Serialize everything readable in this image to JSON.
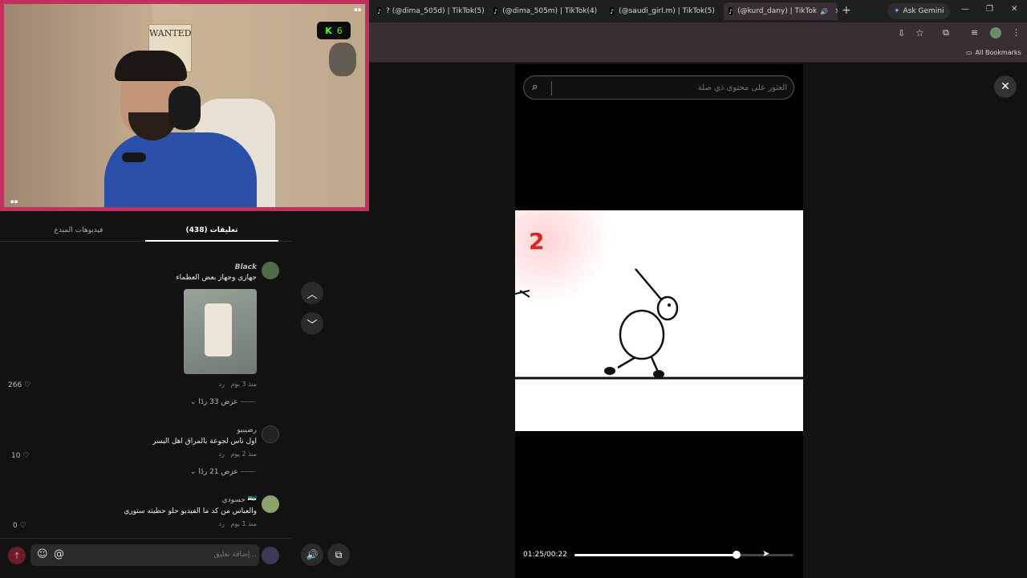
{
  "browser": {
    "tabs": [
      {
        "label": "? (@dima_505d) | TikTok(5)"
      },
      {
        "label": "(@dima_505m) | TikTok(4)"
      },
      {
        "label": "(@saudi_girl.m) | TikTok(5)"
      },
      {
        "label": "(@kurd_dany) | TikTok"
      }
    ],
    "ask_gemini": "Ask Gemini",
    "all_bookmarks": "All Bookmarks"
  },
  "overlay": {
    "wanted_text": "WANTED",
    "kick_badge": "6"
  },
  "panel": {
    "tabs": [
      {
        "label": "تعليقات (438)"
      },
      {
        "label": "فيديوهات المبدع"
      }
    ],
    "comments": [
      {
        "name": "Black",
        "text": "جهازي وجهاز بعض العظماء",
        "time": "منذ 3 يوم",
        "reply": "رد",
        "likes": "266",
        "replies": "عرض 33 ردًا"
      },
      {
        "name": "رضيبيو",
        "text": "اول ناس لجوعة بالمراق اهل البسر",
        "time": "منذ 2 يوم",
        "reply": "رد",
        "likes": "10",
        "replies": "عرض 21 ردًا"
      },
      {
        "name": "حسودي 🇸🇾",
        "text": "والعباس من كد ما الفيديو حلو حطيته ستوري",
        "time": "منذ 1 يوم",
        "reply": "رد",
        "likes": "0"
      }
    ],
    "composer_placeholder": "إضافة تعليق..."
  },
  "video": {
    "search_placeholder": "العثور على محتوى ذي صلة",
    "counter": "2",
    "time": "01:25/00:22",
    "progress": 0.74
  },
  "colors": {
    "accent": "#c2305e",
    "kick": "#53fc18"
  }
}
